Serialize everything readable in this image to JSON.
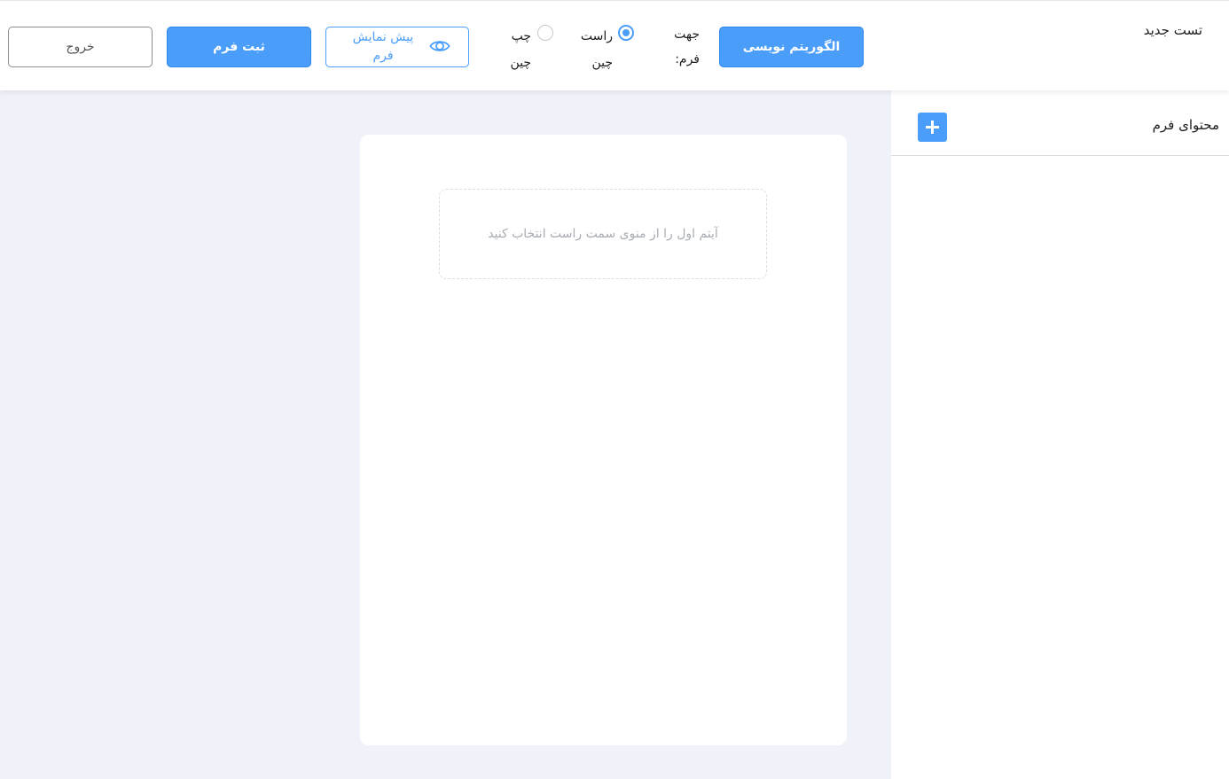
{
  "header": {
    "title": "تست جدید",
    "algorithm_button": "الگوریتم نویسی",
    "direction_label": "جهت فرم:",
    "direction_options": [
      {
        "label": "راست چین",
        "checked": true
      },
      {
        "label": "چپ چین",
        "checked": false
      }
    ],
    "preview_button": "پیش نمایش فرم",
    "preview_icon": "eye-icon",
    "submit_button": "ثبت فرم",
    "exit_button": "خروج"
  },
  "sidebar": {
    "title": "محتوای فرم",
    "add_icon": "plus-icon"
  },
  "canvas": {
    "empty_hint": "آیتم اول را از منوی سمت راست انتخاب کنید"
  },
  "colors": {
    "accent": "#4a9df8",
    "page_bg": "#eff2f9",
    "surface": "#ffffff",
    "hint_text": "#a8acb3"
  }
}
